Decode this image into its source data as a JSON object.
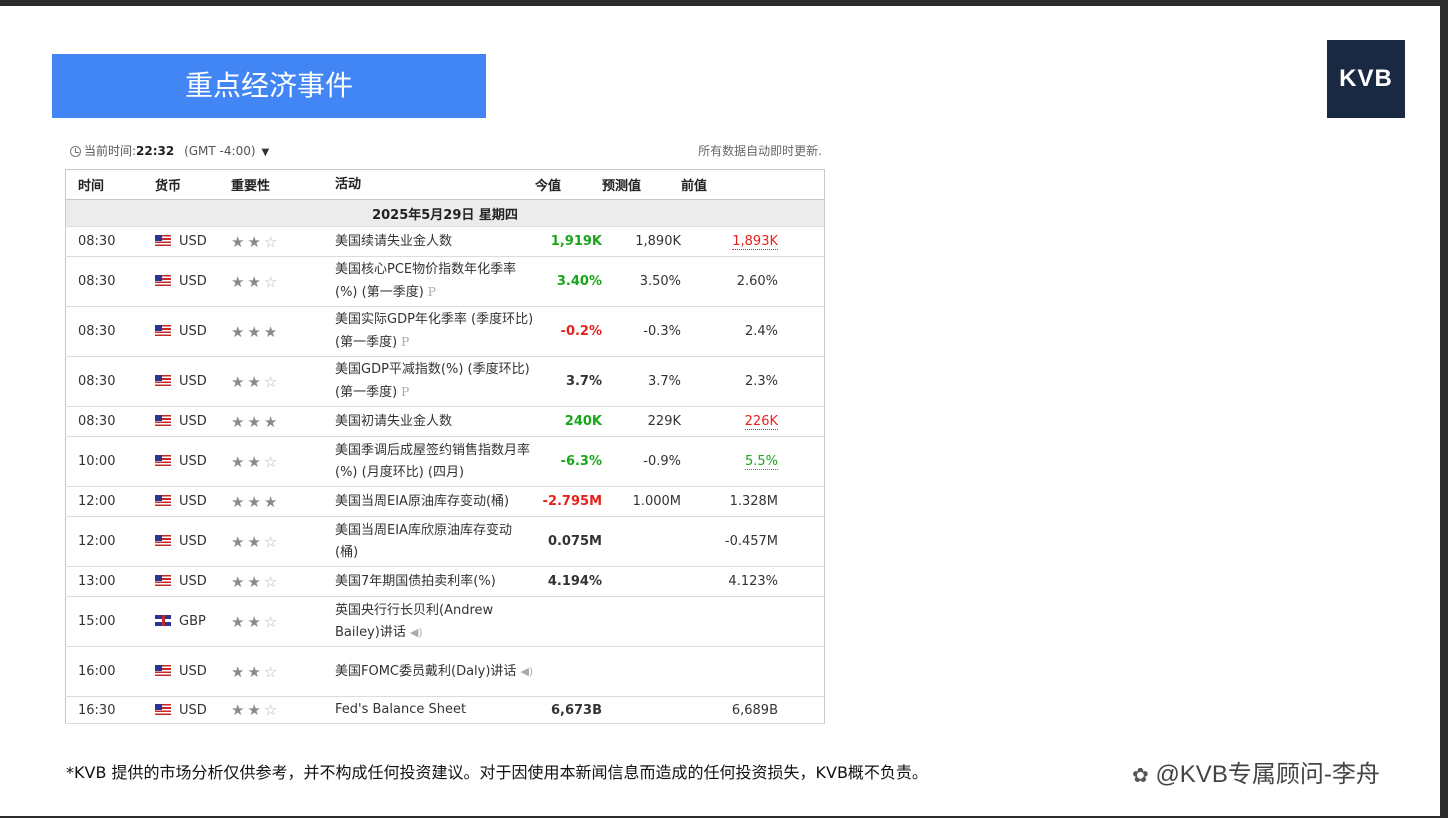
{
  "title": "重点经济事件",
  "logo": "KVB",
  "header": {
    "current_time_label": "当前时间:",
    "current_time": "22:32",
    "timezone": "(GMT -4:00)",
    "auto_update": "所有数据自动即时更新."
  },
  "columns": {
    "time": "时间",
    "currency": "货币",
    "importance": "重要性",
    "event": "活动",
    "actual": "今值",
    "forecast": "预测值",
    "previous": "前值"
  },
  "date_row": "2025年5月29日  星期四",
  "rows": [
    {
      "time": "08:30",
      "currency": "USD",
      "flag": "us",
      "stars": 2,
      "event": "美国续请失业金人数",
      "badge": "",
      "actual": "1,919K",
      "actual_color": "green",
      "forecast": "1,890K",
      "previous": "1,893K",
      "previous_color": "red"
    },
    {
      "time": "08:30",
      "currency": "USD",
      "flag": "us",
      "stars": 2,
      "event": "美国核心PCE物价指数年化季率(%) (第一季度)",
      "badge": "P",
      "actual": "3.40%",
      "actual_color": "green",
      "forecast": "3.50%",
      "previous": "2.60%",
      "previous_color": ""
    },
    {
      "time": "08:30",
      "currency": "USD",
      "flag": "us",
      "stars": 3,
      "event": "美国实际GDP年化季率 (季度环比) (第一季度)",
      "badge": "P",
      "actual": "-0.2%",
      "actual_color": "red",
      "forecast": "-0.3%",
      "previous": "2.4%",
      "previous_color": ""
    },
    {
      "time": "08:30",
      "currency": "USD",
      "flag": "us",
      "stars": 2,
      "event": "美国GDP平减指数(%) (季度环比) (第一季度)",
      "badge": "P",
      "actual": "3.7%",
      "actual_color": "",
      "forecast": "3.7%",
      "previous": "2.3%",
      "previous_color": ""
    },
    {
      "time": "08:30",
      "currency": "USD",
      "flag": "us",
      "stars": 3,
      "event": "美国初请失业金人数",
      "badge": "",
      "actual": "240K",
      "actual_color": "green",
      "forecast": "229K",
      "previous": "226K",
      "previous_color": "red"
    },
    {
      "time": "10:00",
      "currency": "USD",
      "flag": "us",
      "stars": 2,
      "event": "美国季调后成屋签约销售指数月率(%) (月度环比) (四月)",
      "badge": "",
      "actual": "-6.3%",
      "actual_color": "green",
      "forecast": "-0.9%",
      "previous": "5.5%",
      "previous_color": "green"
    },
    {
      "time": "12:00",
      "currency": "USD",
      "flag": "us",
      "stars": 3,
      "event": "美国当周EIA原油库存变动(桶)",
      "badge": "",
      "actual": "-2.795M",
      "actual_color": "red",
      "forecast": "1.000M",
      "previous": "1.328M",
      "previous_color": ""
    },
    {
      "time": "12:00",
      "currency": "USD",
      "flag": "us",
      "stars": 2,
      "event": "美国当周EIA库欣原油库存变动(桶)",
      "badge": "",
      "actual": "0.075M",
      "actual_color": "",
      "forecast": "",
      "previous": "-0.457M",
      "previous_color": ""
    },
    {
      "time": "13:00",
      "currency": "USD",
      "flag": "us",
      "stars": 2,
      "event": "美国7年期国债拍卖利率(%)",
      "badge": "",
      "actual": "4.194%",
      "actual_color": "",
      "forecast": "",
      "previous": "4.123%",
      "previous_color": ""
    },
    {
      "time": "15:00",
      "currency": "GBP",
      "flag": "gb",
      "stars": 2,
      "event": "英国央行行长贝利(Andrew Bailey)讲话",
      "badge": "speaker",
      "actual": "",
      "actual_color": "",
      "forecast": "",
      "previous": "",
      "previous_color": ""
    },
    {
      "time": "16:00",
      "currency": "USD",
      "flag": "us",
      "stars": 2,
      "event": "美国FOMC委员戴利(Daly)讲话",
      "badge": "speaker",
      "actual": "",
      "actual_color": "",
      "forecast": "",
      "previous": "",
      "previous_color": ""
    },
    {
      "time": "16:30",
      "currency": "USD",
      "flag": "us",
      "stars": 2,
      "event": "Fed's Balance Sheet",
      "badge": "",
      "actual": "6,673B",
      "actual_color": "",
      "forecast": "",
      "previous": "6,689B",
      "previous_color": ""
    }
  ],
  "row_heights": [],
  "disclaimer": "*KVB 提供的市场分析仅供参考，并不构成任何投资建议。对于因使用本新闻信息而造成的任何投资损失，KVB概不负责。",
  "watermark": "@KVB专属顾问-李舟",
  "colors": {
    "banner": "#4285f4",
    "logo_bg": "#1a2942",
    "green": "#1aa51a",
    "red": "#e8211c"
  }
}
